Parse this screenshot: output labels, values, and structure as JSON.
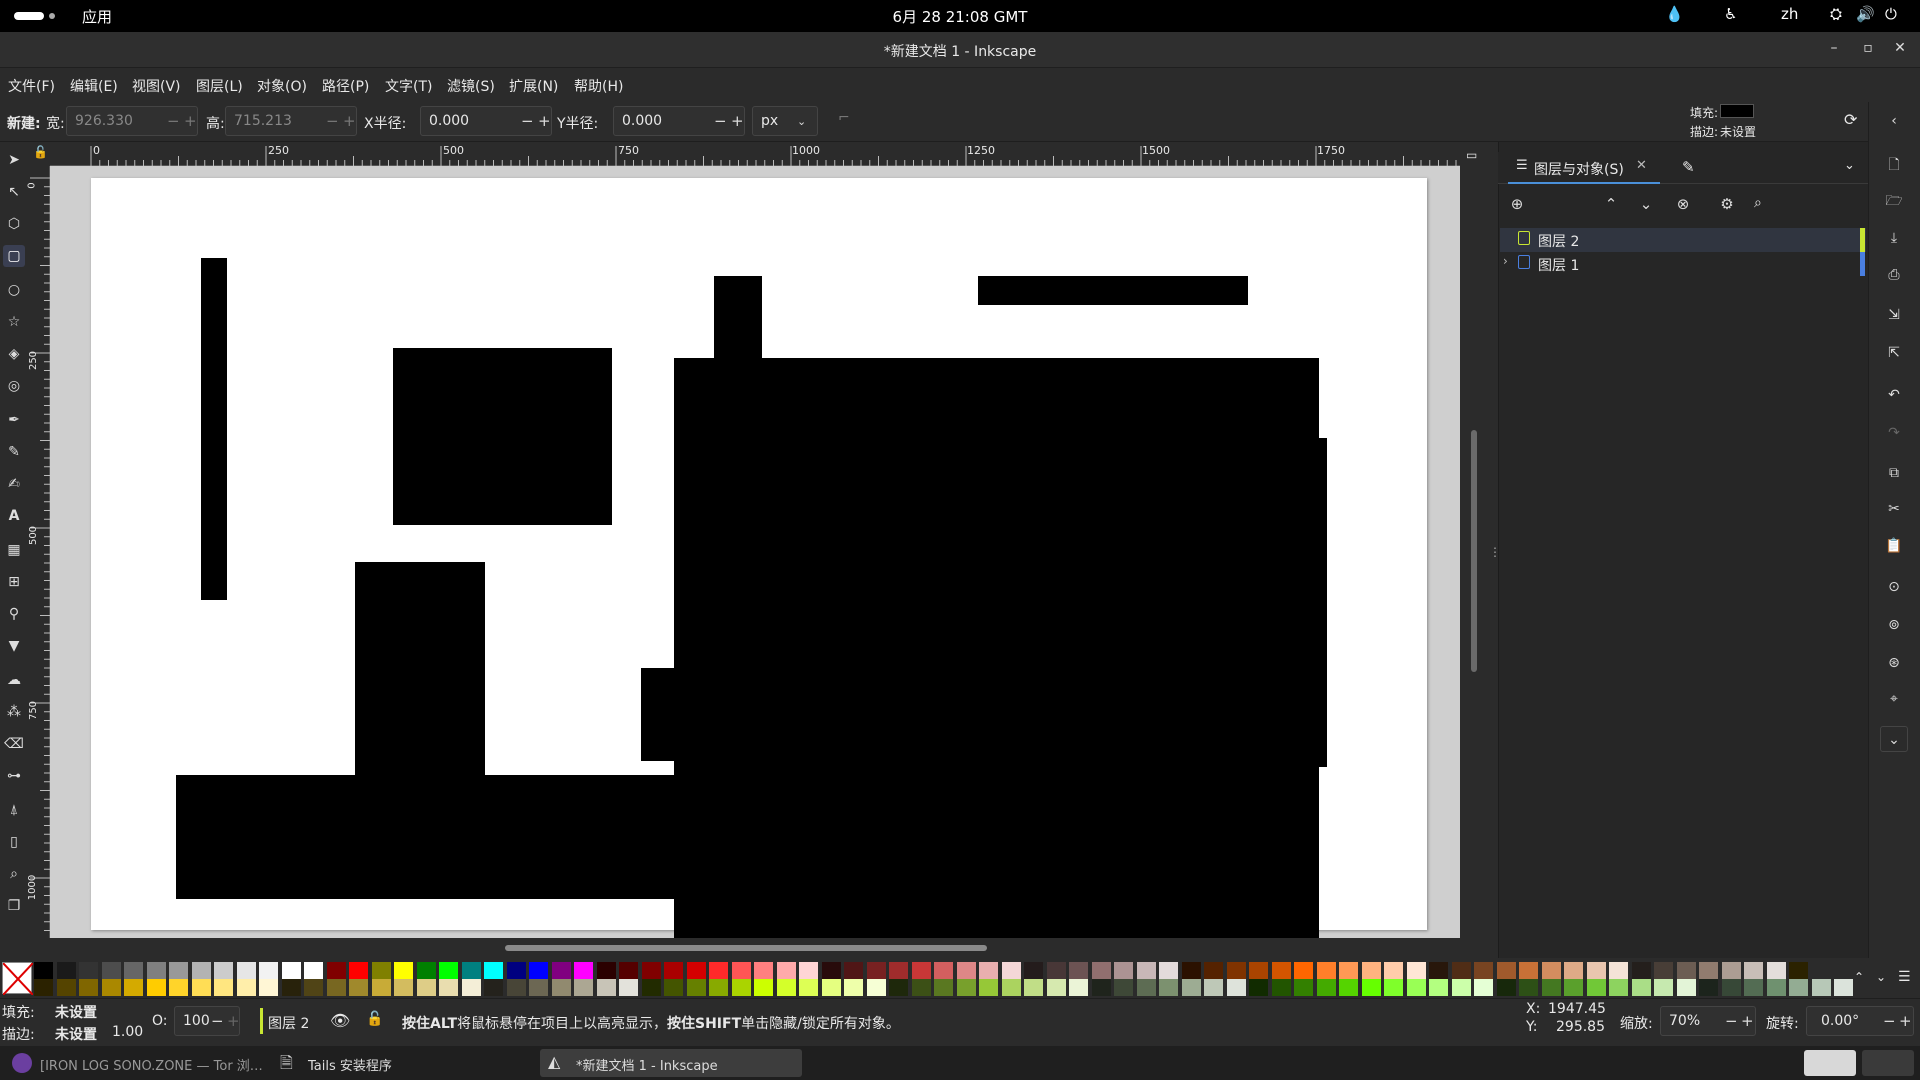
{
  "topbar": {
    "apps": "应用",
    "clock": "6月 28 21:08 GMT",
    "lang": "zh"
  },
  "window": {
    "title": "*新建文档 1 - Inkscape"
  },
  "menubar": [
    "文件(F)",
    "编辑(E)",
    "视图(V)",
    "图层(L)",
    "对象(O)",
    "路径(P)",
    "文字(T)",
    "滤镜(S)",
    "扩展(N)",
    "帮助(H)"
  ],
  "controls": {
    "new_label": "新建:",
    "width_label": "宽:",
    "width_value": "926.330",
    "height_label": "高:",
    "height_value": "715.213",
    "rx_label": "X半径:",
    "rx_value": "0.000",
    "ry_label": "Y半径:",
    "ry_value": "0.000",
    "unit": "px",
    "fill_label": "填充:",
    "stroke_label": "描边:",
    "stroke_value": "未设置"
  },
  "rulers": {
    "h_ticks": [
      "0",
      "250",
      "500",
      "750",
      "1000",
      "1250",
      "1500",
      "1750"
    ],
    "v_ticks": [
      "0",
      "250",
      "500",
      "750",
      "1000"
    ]
  },
  "dock": {
    "tab_label": "图层与对象(S)",
    "layers": [
      {
        "name": "图层 2",
        "color": "#c8e632",
        "selected": true
      },
      {
        "name": "图层 1",
        "color": "#4a7fe0",
        "selected": false
      }
    ]
  },
  "status": {
    "fill_label": "填充:",
    "fill_value": "未设置",
    "stroke_label": "描边:",
    "stroke_value": "未设置",
    "stroke_width": "1.00",
    "opacity_label": "O:",
    "opacity_value": "100",
    "layer": "图层 2",
    "message_b1": "按住ALT",
    "message_t1": "将鼠标悬停在项目上以高亮显示，",
    "message_b2": "按住SHIFT",
    "message_t2": "单击隐藏/锁定所有对象。",
    "x_label": "X:",
    "x_value": "1947.45",
    "y_label": "Y:",
    "y_value": "295.85",
    "zoom_label": "缩放:",
    "zoom_value": "70%",
    "rotate_label": "旋转:",
    "rotate_value": "0.00°"
  },
  "taskbar": [
    {
      "label": "[IRON LOG SONO.ZONE — Tor 浏…",
      "active": false
    },
    {
      "label": "Tails 安装程序",
      "active": false
    },
    {
      "label": "*新建文档 1 - Inkscape",
      "active": true
    }
  ],
  "colors": {
    "accent": "#4a90d9",
    "layer2": "#c8e632",
    "layer1": "#4a7fe0"
  }
}
